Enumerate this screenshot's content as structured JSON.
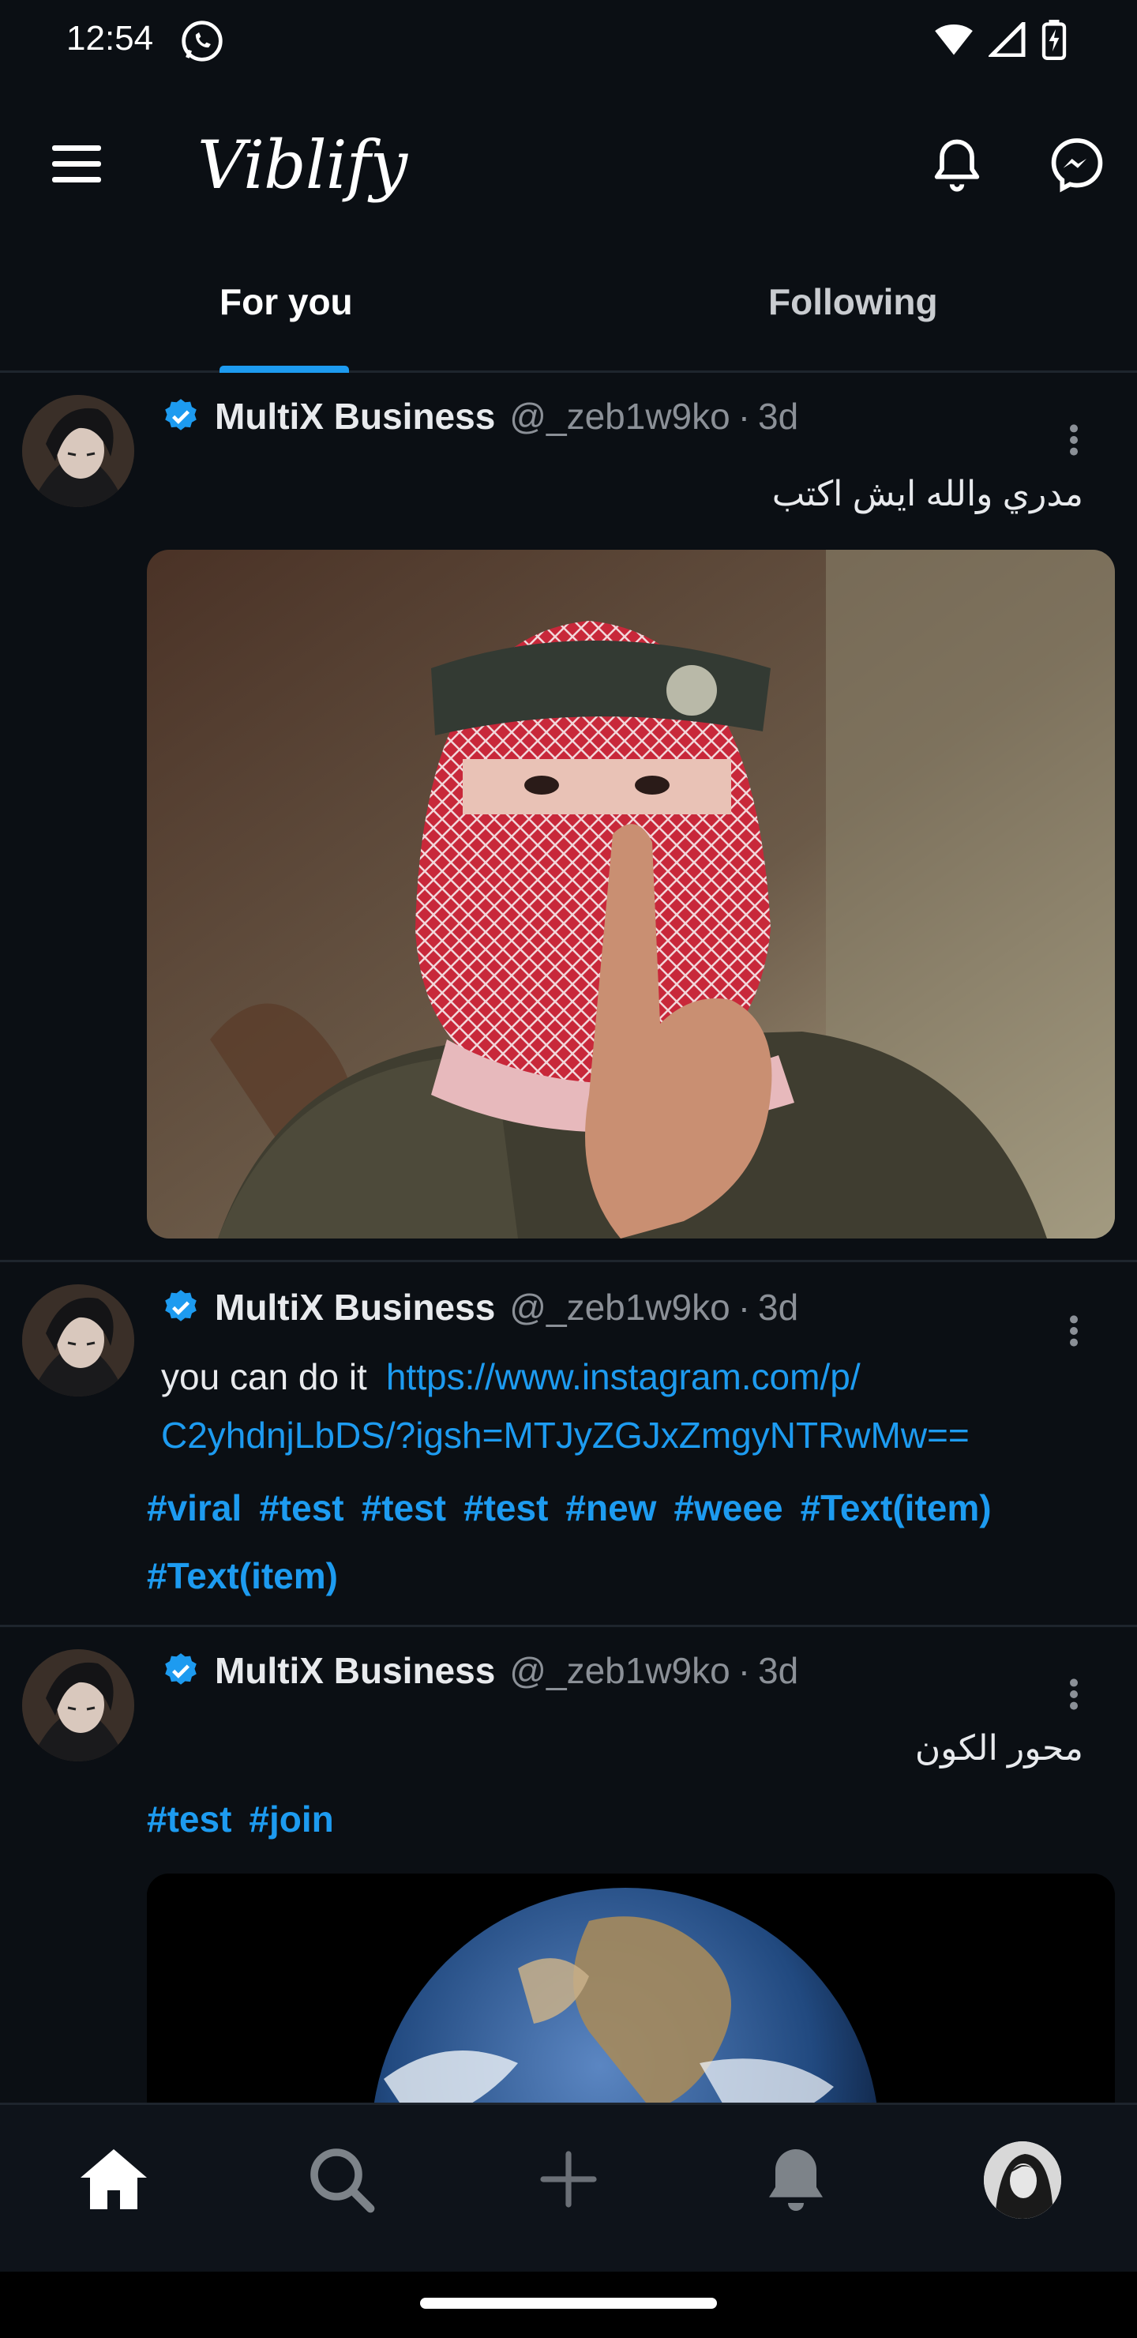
{
  "status_bar": {
    "time": "12:54"
  },
  "app_bar": {
    "title": "Viblify"
  },
  "tabs": [
    {
      "label": "For you",
      "active": true
    },
    {
      "label": "Following",
      "active": false
    }
  ],
  "posts": [
    {
      "name": "MultiX Business",
      "handle": "@_zeb1w9ko",
      "separator": "·",
      "time": "3d",
      "text": "مدري والله ايش اكتب",
      "has_image": true
    },
    {
      "name": "MultiX Business",
      "handle": "@_zeb1w9ko",
      "separator": "·",
      "time": "3d",
      "text": "you can do it",
      "link_line1": "https://www.instagram.com/p/",
      "link_line2": "C2yhdnjLbDS/?igsh=MTJyZGJxZmgyNTRwMw==",
      "hashtags": [
        "#viral",
        "#test",
        "#test",
        "#test",
        "#new",
        "#weee",
        "#Text(item)",
        "#Text(item)"
      ]
    },
    {
      "name": "MultiX Business",
      "handle": "@_zeb1w9ko",
      "separator": "·",
      "time": "3d",
      "text": "محور الكون",
      "hashtags": [
        "#test",
        "#join"
      ],
      "has_image": true
    }
  ],
  "bottom_nav": [
    "home-icon",
    "search-icon",
    "add-icon",
    "notifications-icon",
    "profile-avatar"
  ],
  "colors": {
    "accent": "#1d9bf0",
    "background": "#0b0f14"
  }
}
